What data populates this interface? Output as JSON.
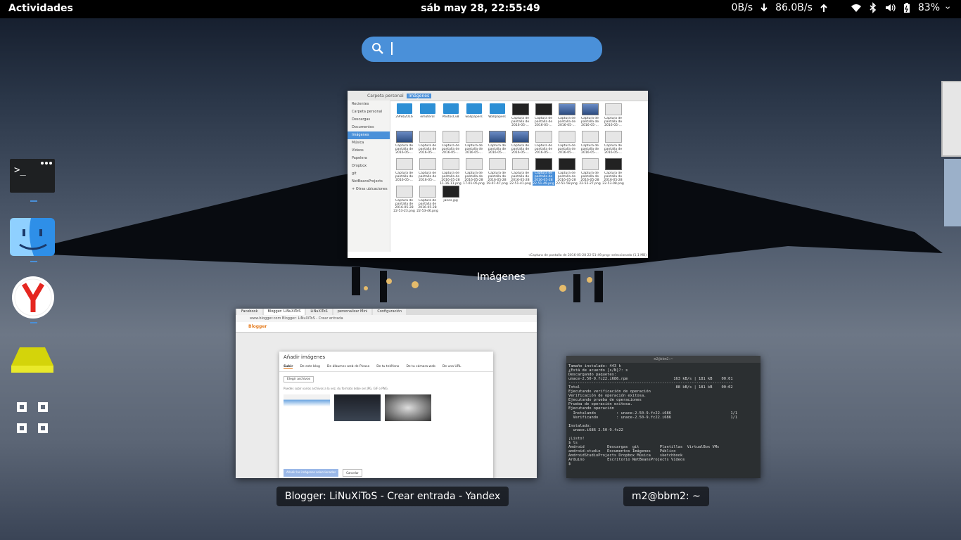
{
  "topbar": {
    "activities": "Actividades",
    "clock": "sáb may 28, 22:55:49",
    "net_up": "0B/s",
    "net_down": "86.0B/s",
    "battery": "83%",
    "icons": [
      "arrow-down-icon",
      "arrow-up-icon",
      "wifi-icon",
      "bluetooth-icon",
      "volume-icon",
      "battery-icon",
      "power-menu-icon"
    ]
  },
  "search": {
    "placeholder": ""
  },
  "dash": {
    "items": [
      {
        "name": "terminal-app",
        "icon": "terminal-icon",
        "running": true
      },
      {
        "name": "finder-app",
        "icon": "finder-face-icon",
        "running": true
      },
      {
        "name": "yandex-browser-app",
        "icon": "yandex-icon",
        "running": true
      },
      {
        "name": "drive-app",
        "icon": "drive-icon",
        "running": false
      },
      {
        "name": "show-apps",
        "icon": "app-grid-icon",
        "running": false
      }
    ]
  },
  "windows": {
    "files": {
      "caption": "Imágenes",
      "path": [
        "Carpeta personal",
        "Imágenes"
      ],
      "sidebar": [
        "Recientes",
        "Carpeta personal",
        "Descargas",
        "Documentos",
        "Imágenes",
        "Música",
        "Vídeos",
        "Papelera",
        "Dropbox",
        "git",
        "NetBeansProjects",
        "+ Otras ubicaciones"
      ],
      "files": [
        {
          "label": "29feb2016",
          "kind": "folder"
        },
        {
          "label": "emoterol",
          "kind": "folder"
        },
        {
          "label": "PhotosCv8",
          "kind": "folder"
        },
        {
          "label": "wallpapers",
          "kind": "folder"
        },
        {
          "label": "Wallpapers",
          "kind": "folder"
        },
        {
          "label": "Captura de pantalla de 2016-05-...",
          "kind": "dark"
        },
        {
          "label": "Captura de pantalla de 2016-05-...",
          "kind": "dark"
        },
        {
          "label": "Captura de pantalla de 2016-05-...",
          "kind": "blue"
        },
        {
          "label": "Captura de pantalla de 2016-05-...",
          "kind": "blue"
        },
        {
          "label": "Captura de pantalla de 2016-05-...",
          "kind": "light"
        },
        {
          "label": "Captura de pantalla de 2016-05-...",
          "kind": "blue"
        },
        {
          "label": "Captura de pantalla de 2016-05-...",
          "kind": "light"
        },
        {
          "label": "Captura de pantalla de 2016-05-...",
          "kind": "light"
        },
        {
          "label": "Captura de pantalla de 2016-05-...",
          "kind": "light"
        },
        {
          "label": "Captura de pantalla de 2016-05-...",
          "kind": "blue"
        },
        {
          "label": "Captura de pantalla de 2016-05-...",
          "kind": "blue"
        },
        {
          "label": "Captura de pantalla de 2016-05-...",
          "kind": "light"
        },
        {
          "label": "Captura de pantalla de 2016-05-...",
          "kind": "light"
        },
        {
          "label": "Captura de pantalla de 2016-05-...",
          "kind": "light"
        },
        {
          "label": "Captura de pantalla de 2016-05-...",
          "kind": "light"
        },
        {
          "label": "Captura de pantalla de 2016-05-...",
          "kind": "light"
        },
        {
          "label": "Captura de pantalla de 2016-05-...",
          "kind": "light"
        },
        {
          "label": "Captura de pantalla de 2016-05-28 11-16-11.png",
          "kind": "light"
        },
        {
          "label": "Captura de pantalla de 2016-05-28 17-01-05.png",
          "kind": "light"
        },
        {
          "label": "Captura de pantalla de 2016-05-28 19-07-47.png",
          "kind": "light"
        },
        {
          "label": "Captura de pantalla de 2016-05-28 22-51-41.png",
          "kind": "light"
        },
        {
          "label": "Captura de pantalla de 2016-05-28 22-51-49.png",
          "kind": "selected"
        },
        {
          "label": "Captura de pantalla de 2016-05-28 22-51-58.png",
          "kind": "dark"
        },
        {
          "label": "Captura de pantalla de 2016-05-28 22-52-27.png",
          "kind": "light"
        },
        {
          "label": "Captura de pantalla de 2016-05-28 22-53-08.png",
          "kind": "dark"
        },
        {
          "label": "Captura de pantalla de 2016-05-28 22-53-23.png",
          "kind": "light"
        },
        {
          "label": "Captura de pantalla de 2016-05-28 22-53-46.png",
          "kind": "light"
        },
        {
          "label": "janes.jpg",
          "kind": "dark"
        }
      ],
      "status": "«Captura de pantalla de 2016-05-28 22-51-49.png» seleccionado (1,1 MB)"
    },
    "browser": {
      "caption": "Blogger: LiNuXiToS - Crear entrada - Yandex",
      "tabs": [
        "Facebook",
        "Blogger: LiNuXiToS",
        "LiNuXiToS",
        "personalizar Mini",
        "Configuración"
      ],
      "url": "www.blogger.com  Blogger: LiNuXiToS - Crear entrada",
      "blog": "Blogger",
      "dialog_title": "Añadir imágenes",
      "dialog_tabs": [
        "Subir",
        "De este blog",
        "De álbumes web de Picasa",
        "De tu teléfono",
        "De tu cámara web",
        "De una URL"
      ],
      "choose_button": "Elegir archivos",
      "hint": "Puedes subir varios archivos a la vez, du formato debe ser JPG, GIF o PNG.",
      "add_button": "Añadir las imágenes seleccionadas",
      "cancel_button": "Cancelar"
    },
    "terminal": {
      "caption": "m2@bbm2: ~",
      "title": "m2@bbm2:~",
      "lines": [
        "Tamaño instalado: 443 k",
        "¿Está de acuerdo [s/N]?: s",
        "Descargando paquetes:",
        "unace-2.50-9.fc22.i686.rpm                    163 kB/s | 181 kB    00:01",
        "------------------------------------------------------------------------",
        "Total                                          88 kB/s | 181 kB    00:02",
        "Ejecutando verificación de operación",
        "Verificación de operación exitosa.",
        "Ejecutando prueba de operaciones",
        "Prueba de operación exitosa.",
        "Ejecutando operación",
        "  Instalando         : unace-2.50-9.fc22.i686                          1/1",
        "  Verificando        : unace-2.50-9.fc22.i686                          1/1",
        "",
        "Instalado:",
        "  unace.i686 2.50-9.fc22",
        "",
        "¡Listo!",
        "$ ls",
        "Android          Descargas  git         Plantillas  VirtualBox VMs",
        "android-studio   Documentos Imágenes    Público",
        "AndroidStudioProjects Dropbox Música    sketchbook",
        "Arduino          Escritorio NetBeansProjects Vídeos",
        "$ "
      ]
    }
  }
}
